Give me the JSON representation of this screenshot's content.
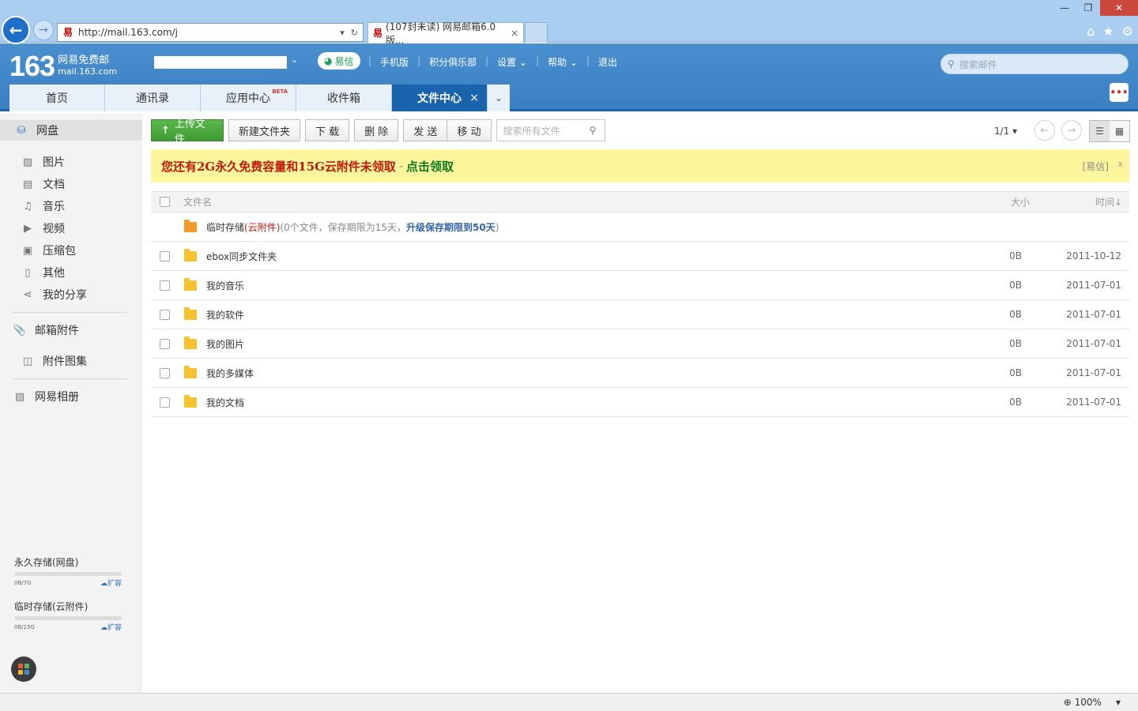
{
  "browser": {
    "url": "http://mail.163.com/j",
    "tab_title": "(107封未读) 网易邮箱6.0版...",
    "tab_close": "×",
    "zoom": "100%"
  },
  "header": {
    "logo_number": "163",
    "logo_name": "网易免费邮",
    "logo_domain": "mail.163.com",
    "yixin": "易信",
    "nav": [
      "手机版",
      "积分俱乐部",
      "设置",
      "帮助",
      "退出"
    ],
    "search_placeholder": "搜索邮件"
  },
  "mail_tabs": [
    {
      "label": "首页"
    },
    {
      "label": "通讯录"
    },
    {
      "label": "应用中心",
      "badge": "BETA"
    },
    {
      "label": "收件箱"
    },
    {
      "label": "文件中心",
      "close": "×"
    }
  ],
  "sidebar": {
    "netdisk": "网盘",
    "items": [
      "图片",
      "文档",
      "音乐",
      "视频",
      "压缩包",
      "其他",
      "我的分享"
    ],
    "mail_attachments": "邮箱附件",
    "attachment_album": "附件图集",
    "photo_album": "网易相册",
    "storage": [
      {
        "label": "永久存储(网盘)",
        "usage": "0B/7G",
        "expand": "扩容",
        "fraction": 0.0
      },
      {
        "label": "临时存储(云附件)",
        "usage": "0B/15G",
        "expand": "扩容",
        "fraction": 0.0
      }
    ]
  },
  "toolbar": {
    "upload": "上传文件",
    "new_folder": "新建文件夹",
    "download": "下 载",
    "delete": "删 除",
    "send": "发 送",
    "move": "移 动",
    "search_placeholder": "搜索所有文件",
    "pager": "1/1"
  },
  "promo": {
    "message": "您还有2G永久免费容量和15G云附件未领取",
    "dash": "-",
    "claim": "点击领取",
    "source": "[易信]",
    "close": "x"
  },
  "table": {
    "col_name": "文件名",
    "col_size": "大小",
    "col_time": "时间↓",
    "temp_row": {
      "name": "临时存储",
      "cloud": "(云附件)",
      "info": "(0个文件，保存期限为15天，",
      "upgrade": "升级保存期限到50天",
      "end": ")"
    },
    "rows": [
      {
        "name": "ebox同步文件夹",
        "size": "0B",
        "time": "2011-10-12"
      },
      {
        "name": "我的音乐",
        "size": "0B",
        "time": "2011-07-01"
      },
      {
        "name": "我的软件",
        "size": "0B",
        "time": "2011-07-01"
      },
      {
        "name": "我的图片",
        "size": "0B",
        "time": "2011-07-01"
      },
      {
        "name": "我的多媒体",
        "size": "0B",
        "time": "2011-07-01"
      },
      {
        "name": "我的文档",
        "size": "0B",
        "time": "2011-07-01"
      }
    ]
  },
  "colors": {
    "brand_blue": "#1a63ad",
    "upload_green": "#3f9a33",
    "promo_bg": "#fef69c",
    "promo_red": "#c0180c",
    "promo_green": "#0b7a1e",
    "folder_yellow": "#f8c22e"
  },
  "icons": [
    "back-arrow-icon",
    "forward-arrow-icon",
    "refresh-icon",
    "home-icon",
    "star-icon",
    "gear-icon",
    "search-icon",
    "folder-icon",
    "picture-icon",
    "document-icon",
    "music-icon",
    "video-icon",
    "archive-icon",
    "file-icon",
    "share-icon",
    "paperclip-icon",
    "album-icon",
    "cloud-upload-icon",
    "apps-icon"
  ]
}
